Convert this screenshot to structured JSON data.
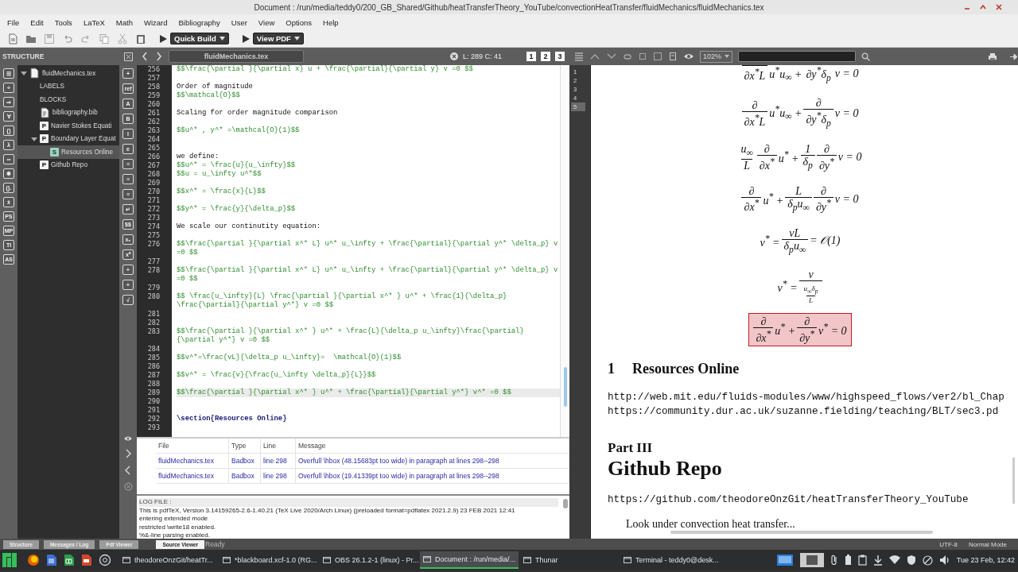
{
  "window": {
    "title": "Document : /run/media/teddy0/200_GB_Shared/Github/heatTransferTheory_YouTube/convectionHeatTransfer/fluidMechanics/fluidMechanics.tex"
  },
  "menu": [
    "File",
    "Edit",
    "Tools",
    "LaTeX",
    "Math",
    "Wizard",
    "Bibliography",
    "User",
    "View",
    "Options",
    "Help"
  ],
  "toolbar": {
    "buttons": [
      "Quick Build",
      "View PDF"
    ]
  },
  "structure": {
    "title": "STRUCTURE",
    "symbols": [
      "☰",
      "÷",
      "⇒",
      "∀",
      "{}",
      "λ",
      "∞",
      "✱",
      "(}.",
      "ẋ",
      "PS",
      "MP",
      "TI",
      "AS"
    ],
    "tree": [
      {
        "label": "fluidMechanics.tex",
        "kind": "file",
        "expanded": true,
        "selected": false,
        "children": [
          {
            "label": "LABELS",
            "kind": "group",
            "selected": false
          },
          {
            "label": "BLOCKS",
            "kind": "group",
            "selected": false
          },
          {
            "label": "bibliography.bib",
            "kind": "bib",
            "selected": false
          },
          {
            "label": "Navier Stokes Equati",
            "kind": "part",
            "badge": "P",
            "selected": false
          },
          {
            "label": "Boundary Layer Equat",
            "kind": "part",
            "badge": "P",
            "expanded": true,
            "selected": false,
            "children": [
              {
                "label": "Resources Online",
                "kind": "section",
                "badge": "S",
                "selected": true
              }
            ]
          },
          {
            "label": "Github Repo",
            "kind": "part",
            "badge": "P",
            "selected": false
          }
        ]
      }
    ]
  },
  "symbol_bar": [
    "+",
    "ref",
    "A",
    "B",
    "i",
    "e",
    "≡",
    "≡",
    "≡",
    "↵",
    "$$",
    "x₀",
    "x⁰",
    "÷",
    "÷",
    "√"
  ],
  "editor": {
    "tab": "fluidMechanics.tex",
    "cursor": "L: 289 C: 41",
    "bookmarks": [
      "1",
      "2",
      "3"
    ],
    "lines": [
      {
        "n": "256",
        "kind": "math",
        "current": false,
        "text": "$$\\frac{\\partial }{\\partial x} u + \\frac{\\partial}{\\partial y} v =0 $$"
      },
      {
        "n": "257",
        "current": false
      },
      {
        "n": "258",
        "kind": "text",
        "current": false,
        "text": "Order of magnitude"
      },
      {
        "n": "259",
        "kind": "math",
        "current": false,
        "text": "$$\\mathcal{O}$$"
      },
      {
        "n": "260",
        "current": false
      },
      {
        "n": "261",
        "kind": "text",
        "current": false,
        "text": "Scaling for order magnitude comparison"
      },
      {
        "n": "262",
        "current": false
      },
      {
        "n": "263",
        "kind": "math",
        "current": false,
        "text": "$$u^* , y^* =\\mathcal{O}(1)$$"
      },
      {
        "n": "264",
        "current": false
      },
      {
        "n": "265",
        "current": false
      },
      {
        "n": "266",
        "kind": "text",
        "current": false,
        "text": "we define:"
      },
      {
        "n": "267",
        "kind": "math",
        "current": false,
        "text": "$$u^* = \\frac{u}{u_\\infty}$$"
      },
      {
        "n": "268",
        "kind": "math",
        "current": false,
        "text": "$$u = u_\\infty u^*$$"
      },
      {
        "n": "269",
        "current": false
      },
      {
        "n": "270",
        "kind": "math",
        "current": false,
        "text": "$$x^* = \\frac{x}{L}$$"
      },
      {
        "n": "271",
        "current": false
      },
      {
        "n": "272",
        "kind": "math",
        "current": false,
        "text": "$$y^* = \\frac{y}{\\delta_p}$$"
      },
      {
        "n": "273",
        "current": false
      },
      {
        "n": "274",
        "kind": "text",
        "current": false,
        "text": "We scale our continutity equation:"
      },
      {
        "n": "275",
        "current": false
      },
      {
        "n": "276",
        "kind": "math",
        "current": false,
        "text": "$$\\frac{\\partial }{\\partial x^* L} u^* u_\\infty + \\frac{\\partial}{\\partial y^* \\delta_p} v =0 $$"
      },
      {
        "n": "277",
        "current": false
      },
      {
        "n": "278",
        "kind": "math",
        "current": false,
        "text": "$$\\frac{\\partial }{\\partial x^* L} u^* u_\\infty + \\frac{\\partial}{\\partial y^* \\delta_p} v =0 $$"
      },
      {
        "n": "279",
        "current": false
      },
      {
        "n": "280",
        "kind": "math",
        "current": false,
        "text": "$$ \\frac{u_\\infty}{L} \\frac{\\partial }{\\partial x^* } u^* + \\frac{1}{\\delta_p} \\frac{\\partial}{\\partial y^*} v =0 $$"
      },
      {
        "n": "281",
        "current": false
      },
      {
        "n": "282",
        "current": false
      },
      {
        "n": "283",
        "kind": "math",
        "current": false,
        "text": "$$\\frac{\\partial }{\\partial x^* } u^* + \\frac{L}{\\delta_p u_\\infty}\\frac{\\partial}{\\partial y^*} v =0 $$"
      },
      {
        "n": "284",
        "current": false
      },
      {
        "n": "285",
        "kind": "math",
        "current": false,
        "text": "$$v^*=\\frac{vL}{\\delta_p u_\\infty}=  \\mathcal{O}(1)$$"
      },
      {
        "n": "286",
        "current": false
      },
      {
        "n": "287",
        "kind": "math",
        "current": false,
        "text": "$$v^* = \\frac{v}{\\frac{u_\\infty \\delta_p}{L}}$$"
      },
      {
        "n": "288",
        "current": false
      },
      {
        "n": "289",
        "kind": "math",
        "current": true,
        "text": "$$\\frac{\\partial }{\\partial x^* } u^* + \\frac{\\partial}{\\partial y^*} v^* =0 $$"
      },
      {
        "n": "290",
        "current": false
      },
      {
        "n": "291",
        "current": false
      },
      {
        "n": "292",
        "kind": "command",
        "current": false,
        "text": "\\section{Resources Online}"
      },
      {
        "n": "293",
        "current": false
      }
    ]
  },
  "messages": {
    "columns": [
      "File",
      "Type",
      "Line",
      "Message"
    ],
    "rows": [
      [
        "fluidMechanics.tex",
        "Badbox",
        "line 298",
        "Overfull \\hbox (48.15683pt too wide) in paragraph at lines 298--298"
      ],
      [
        "fluidMechanics.tex",
        "Badbox",
        "line 298",
        "Overfull \\hbox (19.41339pt too wide) in paragraph at lines 298--298"
      ]
    ]
  },
  "log": {
    "lines": [
      "LOG FILE :",
      "This is pdfTeX, Version 3.14159265-2.6-1.40.21 (TeX Live 2020/Arch Linux) (preloaded format=pdflatex 2021.2.9) 23 FEB 2021 12:41",
      "entering extended mode",
      "restricted \\write18 enabled.",
      "%&-line parsing enabled."
    ]
  },
  "pdf": {
    "zoom": "102%",
    "pages": [
      {
        "label": "1",
        "selected": false
      },
      {
        "label": "2",
        "selected": false
      },
      {
        "label": "3",
        "selected": false
      },
      {
        "label": "4",
        "selected": false
      },
      {
        "label": "5",
        "selected": true
      }
    ],
    "equations": [
      {
        "boxed": false,
        "parts": [
          {
            "d": "∂x$^{*}$L"
          },
          "u$^{*}$u$_{∞}$ + ",
          {
            "d": "∂y$^{*}$δ$_{p}$"
          },
          "v = 0"
        ]
      },
      {
        "boxed": false,
        "parts": [
          {
            "n": "∂",
            "d": "∂x$^{*}$L"
          },
          "u$^{*}$u$_{∞}$ + ",
          {
            "n": "∂",
            "d": "∂y$^{*}$δ$_{p}$"
          },
          "v = 0"
        ]
      },
      {
        "boxed": false,
        "parts": [
          {
            "n": "u$_{∞}$",
            "d": "L"
          },
          {
            "n": "∂",
            "d": "∂x$^{*}$"
          },
          "u$^{*}$ + ",
          {
            "n": "1",
            "d": "δ$_{p}$"
          },
          {
            "n": "∂",
            "d": "∂y$^{*}$"
          },
          "v = 0"
        ]
      },
      {
        "boxed": false,
        "parts": [
          {
            "n": "∂",
            "d": "∂x$^{*}$"
          },
          "u$^{*}$ + ",
          {
            "n": "L",
            "d": "δ$_{p}$u$_{∞}$"
          },
          {
            "n": "∂",
            "d": "∂y$^{*}$"
          },
          "v = 0"
        ]
      },
      {
        "boxed": false,
        "parts": [
          "v$^{*}$ = ",
          {
            "n": "vL",
            "d": "δ$_{p}$u$_{∞}$"
          },
          " = 𝒪(1)"
        ]
      },
      {
        "boxed": false,
        "parts": [
          "v$^{*}$ = ",
          {
            "n": "v",
            "d": {
              "n": "u$_{∞}$δ$_{p}$",
              "d": "L"
            }
          }
        ]
      },
      {
        "boxed": true,
        "parts": [
          {
            "n": "∂",
            "d": "∂x$^{*}$"
          },
          "u$^{*}$ + ",
          {
            "n": "∂",
            "d": "∂y$^{*}$"
          },
          "v$^{*}$ = 0"
        ]
      }
    ],
    "section": {
      "number": "1",
      "title": "Resources Online"
    },
    "urls": [
      "http://web.mit.edu/fluids-modules/www/highspeed_flows/ver2/bl_Chap",
      "https://community.dur.ac.uk/suzanne.fielding/teaching/BLT/sec3.pd"
    ],
    "part": {
      "label": "Part III",
      "title": "Github Repo"
    },
    "repo_url": "https://github.com/theodoreOnzGit/heatTransferTheory_YouTube",
    "note": "Look under convection heat transfer..."
  },
  "status_bar": {
    "tabs": [
      {
        "label": "Structure",
        "selected": false
      },
      {
        "label": "Messages / Log",
        "selected": false
      },
      {
        "label": "Pdf Viewer",
        "selected": false
      },
      {
        "label": "Source Viewer",
        "selected": true
      }
    ],
    "status": "Ready",
    "encoding": "UTF-8",
    "mode": "Normal Mode"
  },
  "taskbar": {
    "tasks": [
      {
        "label": "theodoreOnzGit/heatTr...",
        "selected": false
      },
      {
        "label": "*blackboard.xcf-1.0 (RG...",
        "selected": false
      },
      {
        "label": "OBS 26.1.2-1 (linux) - Pr...",
        "selected": false
      },
      {
        "label": "Document : /run/media/...",
        "selected": true
      },
      {
        "label": "Thunar",
        "selected": false
      },
      {
        "label": "Terminal - teddy0@desk...",
        "selected": false
      }
    ],
    "clock": "Tue 23 Feb, 12:42"
  }
}
